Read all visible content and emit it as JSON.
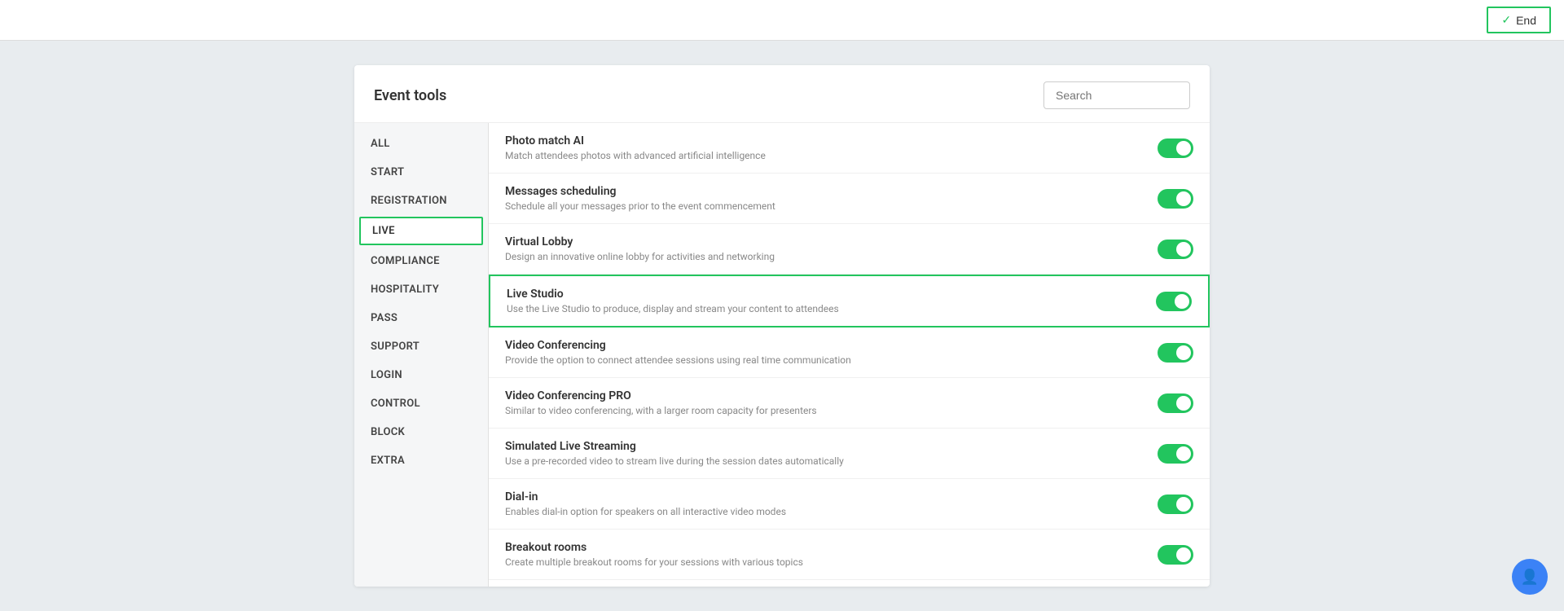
{
  "topbar": {
    "end_button_label": "End",
    "check_symbol": "✓"
  },
  "panel": {
    "title": "Event tools",
    "search_placeholder": "Search"
  },
  "sidebar": {
    "items": [
      {
        "id": "all",
        "label": "ALL",
        "active": false
      },
      {
        "id": "start",
        "label": "START",
        "active": false
      },
      {
        "id": "registration",
        "label": "REGISTRATION",
        "active": false
      },
      {
        "id": "live",
        "label": "LIVE",
        "active": true
      },
      {
        "id": "compliance",
        "label": "COMPLIANCE",
        "active": false
      },
      {
        "id": "hospitality",
        "label": "HOSPITALITY",
        "active": false
      },
      {
        "id": "pass",
        "label": "PASS",
        "active": false
      },
      {
        "id": "support",
        "label": "SUPPORT",
        "active": false
      },
      {
        "id": "login",
        "label": "LOGIN",
        "active": false
      },
      {
        "id": "control",
        "label": "CONTROL",
        "active": false
      },
      {
        "id": "block",
        "label": "BLOCK",
        "active": false
      },
      {
        "id": "extra",
        "label": "EXTRA",
        "active": false
      }
    ]
  },
  "tools": [
    {
      "id": "photo-match-ai",
      "name": "Photo match AI",
      "desc": "Match attendees photos with advanced artificial intelligence",
      "enabled": true,
      "highlighted": false
    },
    {
      "id": "messages-scheduling",
      "name": "Messages scheduling",
      "desc": "Schedule all your messages prior to the event commencement",
      "enabled": true,
      "highlighted": false
    },
    {
      "id": "virtual-lobby",
      "name": "Virtual Lobby",
      "desc": "Design an innovative online lobby for activities and networking",
      "enabled": true,
      "highlighted": false
    },
    {
      "id": "live-studio",
      "name": "Live Studio",
      "desc": "Use the Live Studio to produce, display and stream your content to attendees",
      "enabled": true,
      "highlighted": true
    },
    {
      "id": "video-conferencing",
      "name": "Video Conferencing",
      "desc": "Provide the option to connect attendee sessions using real time communication",
      "enabled": true,
      "highlighted": false
    },
    {
      "id": "video-conferencing-pro",
      "name": "Video Conferencing PRO",
      "desc": "Similar to video conferencing, with a larger room capacity for presenters",
      "enabled": true,
      "highlighted": false
    },
    {
      "id": "simulated-live-streaming",
      "name": "Simulated Live Streaming",
      "desc": "Use a pre-recorded video to stream live during the session dates automatically",
      "enabled": true,
      "highlighted": false
    },
    {
      "id": "dial-in",
      "name": "Dial-in",
      "desc": "Enables dial-in option for speakers on all interactive video modes",
      "enabled": true,
      "highlighted": false
    },
    {
      "id": "breakout-rooms",
      "name": "Breakout rooms",
      "desc": "Create multiple breakout rooms for your sessions with various topics",
      "enabled": true,
      "highlighted": false
    }
  ],
  "colors": {
    "accent": "#22c55e",
    "highlight_border": "#22c55e"
  }
}
